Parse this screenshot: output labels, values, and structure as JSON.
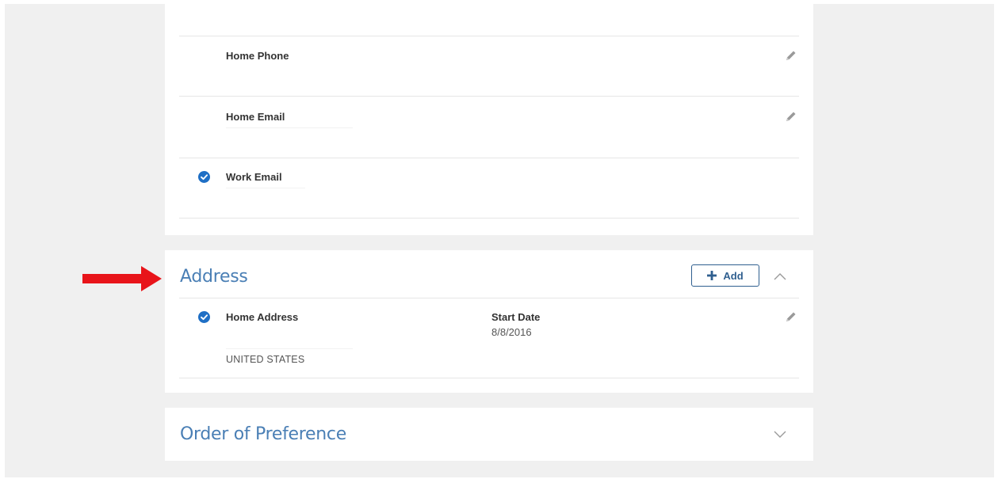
{
  "contact": {
    "home_phone_label": "Home Phone",
    "home_email_label": "Home Email",
    "work_email_label": "Work Email"
  },
  "address": {
    "title": "Address",
    "add_label": "Add",
    "home_address_label": "Home Address",
    "start_date_label": "Start Date",
    "start_date_value": "8/8/2016",
    "country": "UNITED STATES"
  },
  "order_of_preference": {
    "title": "Order of Preference"
  },
  "colors": {
    "accent_blue": "#4a7fb5",
    "check_blue": "#1f6fc5",
    "annotation_red": "#e8141a"
  }
}
